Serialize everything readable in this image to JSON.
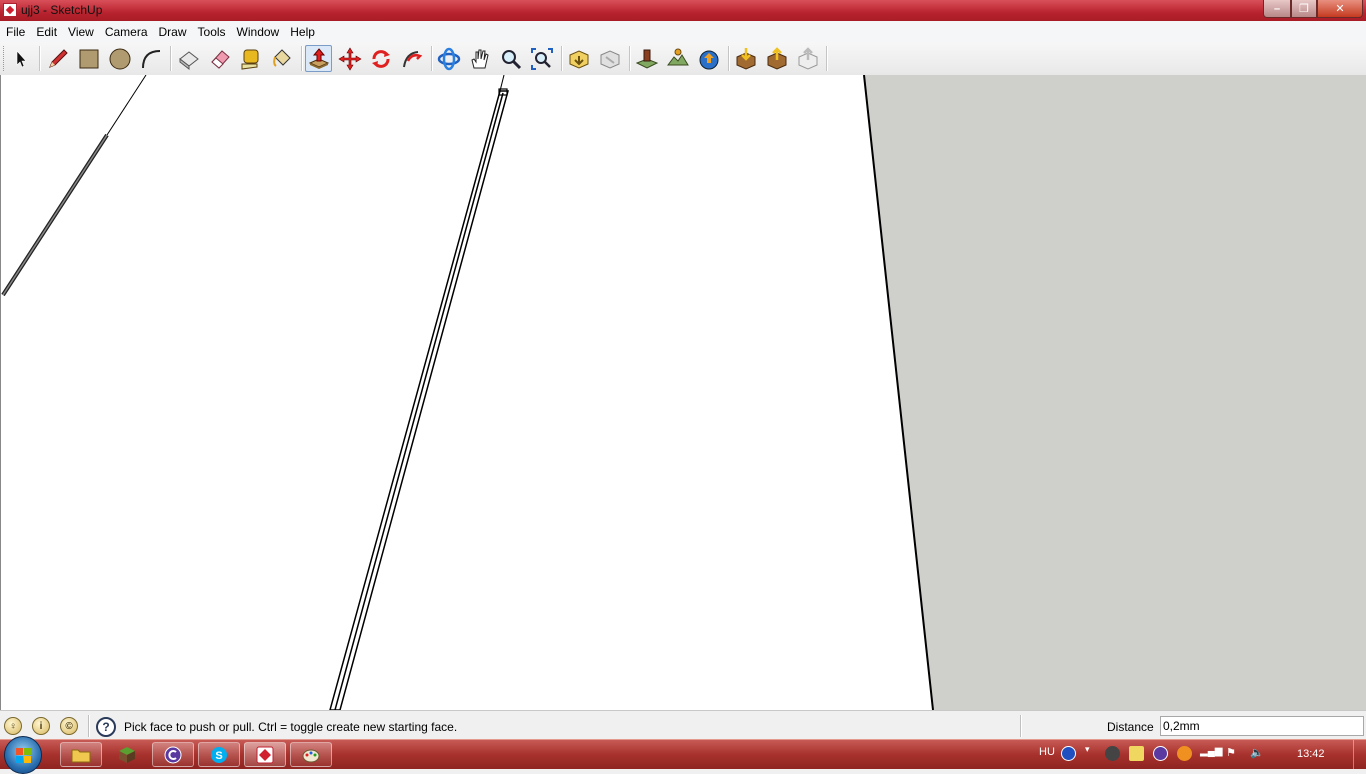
{
  "window": {
    "title": "ujj3 - SketchUp",
    "controls": {
      "minimize": "–",
      "maximize": "❐",
      "close": "✕"
    }
  },
  "menubar": {
    "items": [
      "File",
      "Edit",
      "View",
      "Camera",
      "Draw",
      "Tools",
      "Window",
      "Help"
    ]
  },
  "toolbar": {
    "tools": [
      {
        "name": "select-tool",
        "icon": "arrow-cursor-icon"
      },
      {
        "name": "line-tool",
        "icon": "pencil-icon"
      },
      {
        "name": "rectangle-tool",
        "icon": "rectangle-icon"
      },
      {
        "name": "circle-tool",
        "icon": "circle-icon"
      },
      {
        "name": "arc-tool",
        "icon": "arc-icon"
      },
      {
        "name": "make-component-tool",
        "icon": "component-icon"
      },
      {
        "name": "eraser-tool",
        "icon": "eraser-icon"
      },
      {
        "name": "tape-measure-tool",
        "icon": "tape-measure-icon"
      },
      {
        "name": "paint-bucket-tool",
        "icon": "paint-bucket-icon"
      },
      {
        "name": "push-pull-tool",
        "icon": "push-pull-icon",
        "active": true
      },
      {
        "name": "move-tool",
        "icon": "move-icon"
      },
      {
        "name": "rotate-tool",
        "icon": "rotate-icon"
      },
      {
        "name": "follow-me-tool",
        "icon": "follow-me-icon"
      },
      {
        "name": "orbit-tool",
        "icon": "orbit-icon"
      },
      {
        "name": "pan-tool",
        "icon": "hand-icon"
      },
      {
        "name": "zoom-tool",
        "icon": "magnifier-icon"
      },
      {
        "name": "zoom-extents-tool",
        "icon": "zoom-extents-icon"
      },
      {
        "name": "previous-view-tool",
        "icon": "previous-icon"
      },
      {
        "name": "next-view-tool",
        "icon": "next-icon"
      },
      {
        "name": "add-location-tool",
        "icon": "location-icon"
      },
      {
        "name": "toggle-terrain-tool",
        "icon": "terrain-icon"
      },
      {
        "name": "google-earth-tool",
        "icon": "globe-icon"
      },
      {
        "name": "get-models-tool",
        "icon": "get-models-icon"
      },
      {
        "name": "share-model-tool",
        "icon": "share-model-icon"
      },
      {
        "name": "share-component-tool",
        "icon": "share-component-icon"
      }
    ]
  },
  "statusbar": {
    "hint": "Pick face to push or pull.  Ctrl = toggle create new starting face.",
    "vcb_label": "Distance",
    "vcb_value": "0,2mm",
    "help_glyph": "?",
    "icons": [
      "geolocation-icon",
      "credits-icon",
      "copyright-icon"
    ]
  },
  "taskbar": {
    "apps": [
      {
        "name": "explorer",
        "icon": "folder-icon"
      },
      {
        "name": "minecraft",
        "icon": "grass-block-icon"
      },
      {
        "name": "app-c",
        "icon": "swirl-icon"
      },
      {
        "name": "skype",
        "icon": "skype-icon"
      },
      {
        "name": "sketchup",
        "icon": "sketchup-icon"
      },
      {
        "name": "paint",
        "icon": "palette-icon"
      }
    ],
    "language": "HU",
    "clock": "13:42"
  },
  "colors": {
    "titlebar": "#b8232f",
    "ground": "#cfd0cb",
    "sky": "#ffffff",
    "taskbar": "#a8322d"
  }
}
